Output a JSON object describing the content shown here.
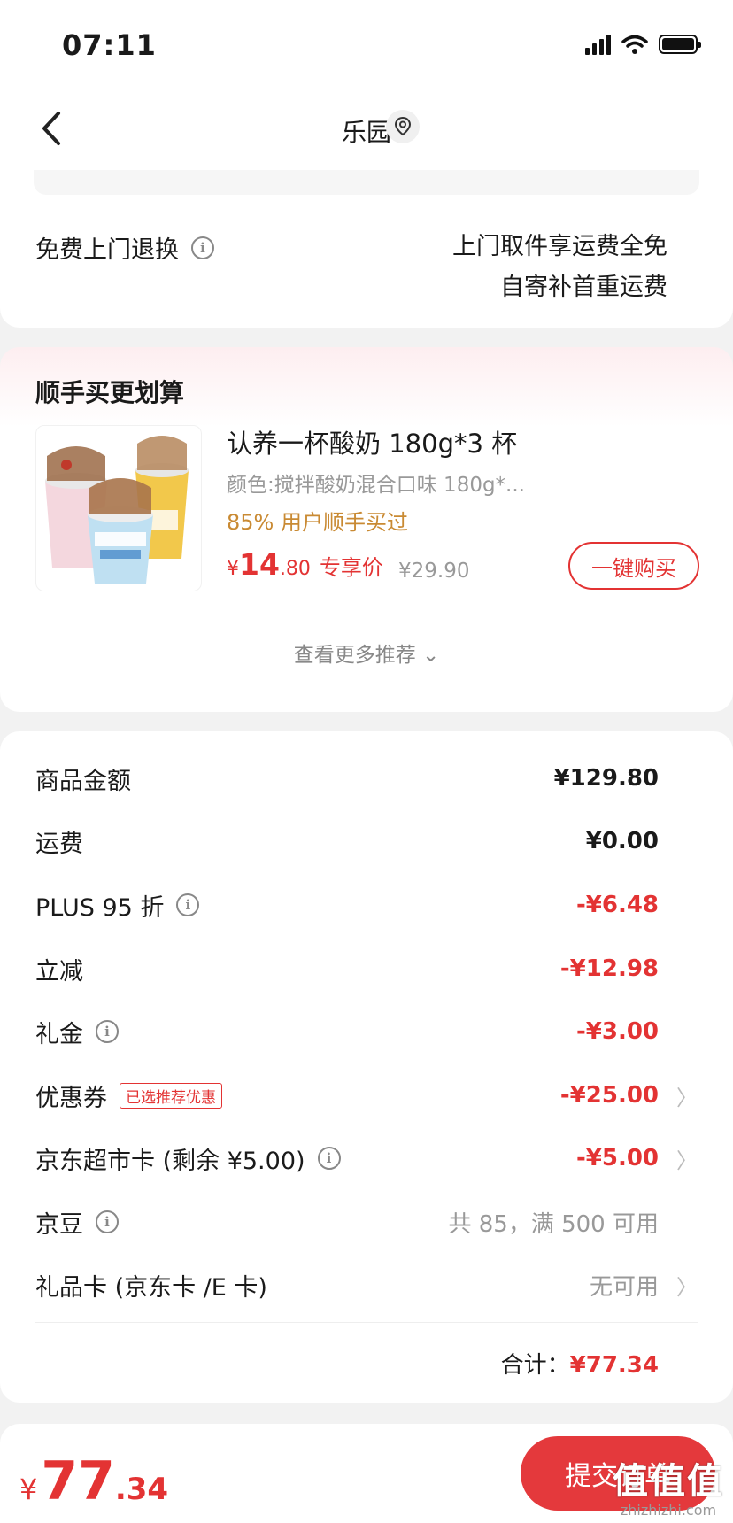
{
  "status_bar": {
    "time": "07:11"
  },
  "nav": {
    "title": "乐园"
  },
  "return_service": {
    "label": "免费上门退换",
    "line1": "上门取件享运费全免",
    "line2": "自寄补首重运费"
  },
  "recommend": {
    "title": "顺手买更划算",
    "product": {
      "name": "认养一杯酸奶 180g*3 杯",
      "spec": "颜色:搅拌酸奶混合口味 180g*...",
      "bought": "85% 用户顺手买过",
      "price_currency": "¥",
      "price_int": "14",
      "price_dec": ".80",
      "price_label": "专享价",
      "orig_price": "¥29.90",
      "buy_label": "一键购买"
    },
    "more_label": "查看更多推荐 ⌄"
  },
  "summary": {
    "rows": [
      {
        "label": "商品金额",
        "value": "¥129.80"
      },
      {
        "label": "运费",
        "value": "¥0.00"
      },
      {
        "label": "PLUS 95 折",
        "value": "-¥6.48"
      },
      {
        "label": "立减",
        "value": "-¥12.98"
      },
      {
        "label": "礼金",
        "value": "-¥3.00"
      },
      {
        "label": "优惠券",
        "badge": "已选推荐优惠",
        "value": "-¥25.00"
      },
      {
        "label": "京东超市卡 (剩余 ¥5.00)",
        "value": "-¥5.00"
      },
      {
        "label": "京豆",
        "value": "共 85，满 500 可用"
      },
      {
        "label": "礼品卡 (京东卡 /E 卡)",
        "value": "无可用"
      }
    ],
    "total_label": "合计：",
    "total_value": "¥77.34"
  },
  "bottom": {
    "currency": "¥",
    "price_int": "77",
    "price_dec": ".34",
    "submit_label": "提交订单"
  },
  "watermark": {
    "text": "值值值",
    "sub": "zhizhizhi.com"
  },
  "colors": {
    "accent_red": "#e33333",
    "gold": "#c98a33"
  },
  "icons": [
    "chevron-left-icon",
    "location-icon",
    "info-icon",
    "chevron-right-icon",
    "signal-icon",
    "wifi-icon",
    "battery-icon"
  ]
}
